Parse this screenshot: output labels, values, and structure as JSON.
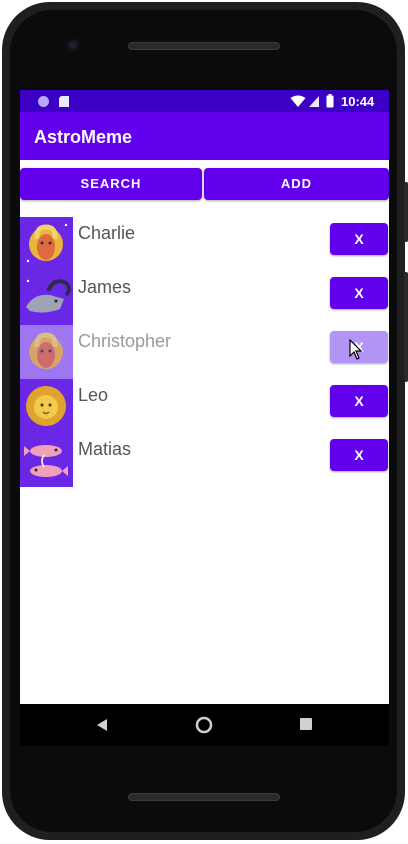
{
  "status": {
    "time": "10:44"
  },
  "app": {
    "title": "AstroMeme"
  },
  "actions": {
    "search_label": "SEARCH",
    "add_label": "ADD"
  },
  "items": [
    {
      "name": "Charlie",
      "sign_icon": "aries-icon",
      "remove_label": "X"
    },
    {
      "name": "James",
      "sign_icon": "capricorn-icon",
      "remove_label": "X"
    },
    {
      "name": "Christopher",
      "sign_icon": "aries-icon",
      "remove_label": "X"
    },
    {
      "name": "Leo",
      "sign_icon": "leo-icon",
      "remove_label": "X"
    },
    {
      "name": "Matias",
      "sign_icon": "pisces-icon",
      "remove_label": "X"
    }
  ],
  "colors": {
    "primary": "#6200ee",
    "status_bar": "#3c00c4"
  }
}
